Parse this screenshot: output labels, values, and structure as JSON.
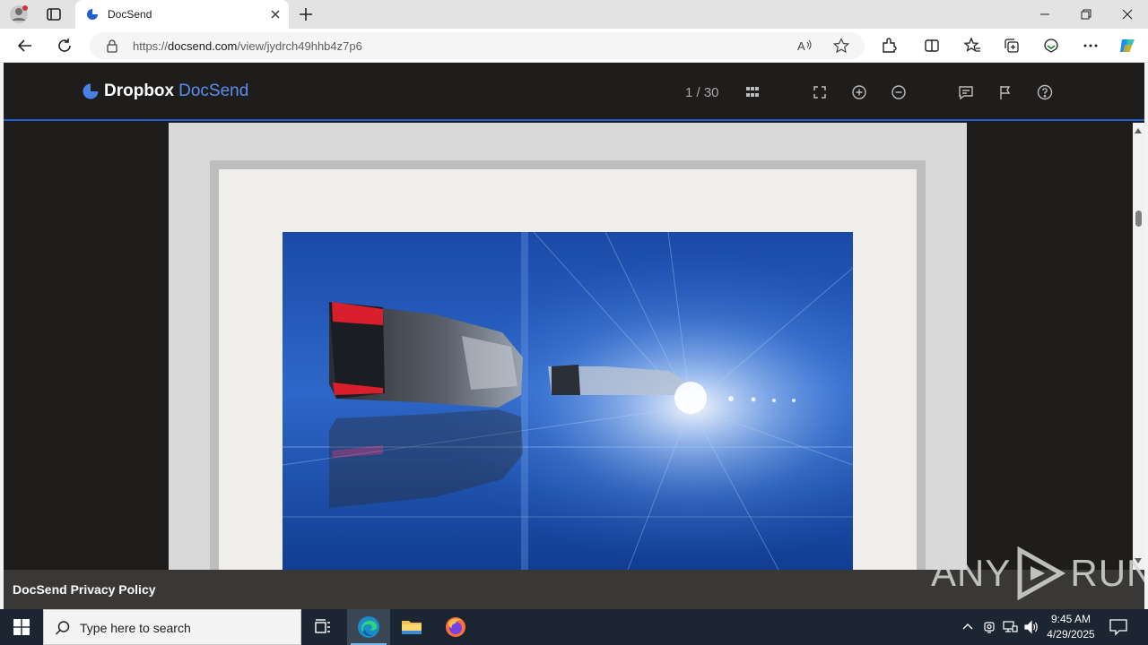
{
  "browser": {
    "tab_title": "DocSend",
    "url_prefix": "https://",
    "url_host": "docsend.com",
    "url_path": "/view/jydrch49hhb4z7p6"
  },
  "docsend": {
    "logo_word1": "Dropbox",
    "logo_word2": "DocSend",
    "page_counter": "1 / 30",
    "footer_link": "DocSend Privacy Policy",
    "accent_color": "#1f5fd1",
    "scroll_position_fraction": 0.05
  },
  "watermark": {
    "left_text": "ANY",
    "right_text": "RUN"
  },
  "taskbar": {
    "search_placeholder": "Type here to search",
    "time": "9:45 AM",
    "date": "4/29/2025"
  }
}
